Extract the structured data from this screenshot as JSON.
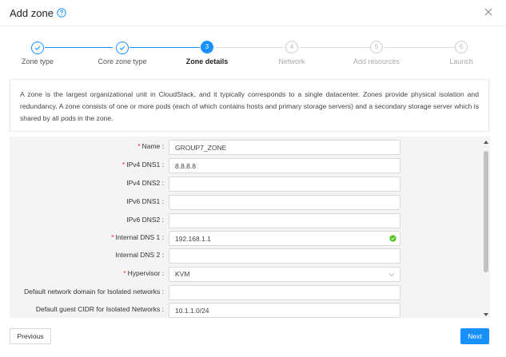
{
  "dialog": {
    "title": "Add zone",
    "help_icon": "question-circle-icon",
    "close_icon": "close-icon"
  },
  "steps": [
    {
      "label": "Zone type",
      "status": "done",
      "number": "1"
    },
    {
      "label": "Core zone type",
      "status": "done",
      "number": "2"
    },
    {
      "label": "Zone details",
      "status": "active",
      "number": "3"
    },
    {
      "label": "Network",
      "status": "wait",
      "number": "4"
    },
    {
      "label": "Add resources",
      "status": "wait",
      "number": "5"
    },
    {
      "label": "Launch",
      "status": "wait",
      "number": "6"
    }
  ],
  "description": "A zone is the largest organizational unit in CloudStack, and it typically corresponds to a single datacenter. Zones provide physical isolation and redundancy. A zone consists of one or more pods (each of which contains hosts and primary storage servers) and a secondary storage server which is shared by all pods in the zone.",
  "form": {
    "fields": [
      {
        "label": "Name",
        "required": true,
        "value": "GROUP7_ZONE"
      },
      {
        "label": "IPv4 DNS1",
        "required": true,
        "value": "8.8.8.8"
      },
      {
        "label": "IPv4 DNS2",
        "required": false,
        "value": ""
      },
      {
        "label": "IPv6 DNS1",
        "required": false,
        "value": ""
      },
      {
        "label": "IPv6 DNS2",
        "required": false,
        "value": ""
      },
      {
        "label": "Internal DNS 1",
        "required": true,
        "value": "192.168.1.1",
        "valid": true
      },
      {
        "label": "Internal DNS 2",
        "required": false,
        "value": ""
      },
      {
        "label": "Hypervisor",
        "required": true,
        "value": "KVM",
        "type": "select"
      },
      {
        "label": "Default network domain for Isolated networks",
        "required": false,
        "value": ""
      },
      {
        "label": "Default guest CIDR for Isolated Networks",
        "required": false,
        "value": "10.1.1.0/24"
      }
    ]
  },
  "footer": {
    "previous_label": "Previous",
    "next_label": "Next"
  },
  "colors": {
    "accent": "#1890ff",
    "required": "#f5222d",
    "valid": "#52c41a"
  }
}
